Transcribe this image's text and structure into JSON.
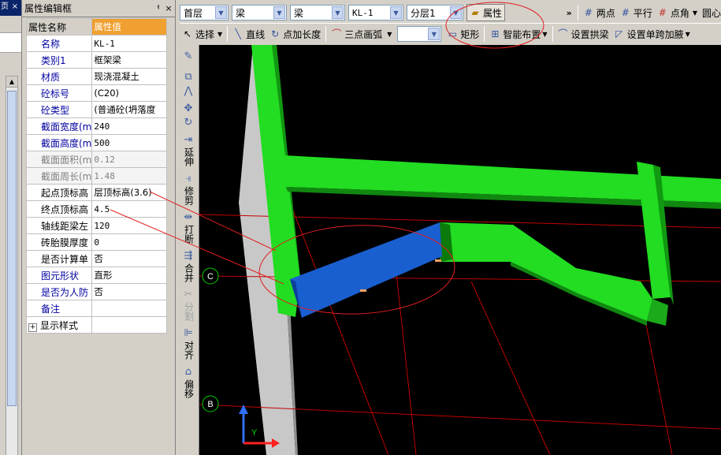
{
  "left_strip": {
    "tab_label": "页",
    "close": "×"
  },
  "prop_panel": {
    "title": "属性编辑框",
    "pin": "ᅣ",
    "close": "×",
    "header": {
      "name": "属性名称",
      "value": "属性值"
    },
    "rows": [
      {
        "name": "名称",
        "value": "KL-1",
        "color": "blue"
      },
      {
        "name": "类别1",
        "value": "框架梁",
        "color": "blue"
      },
      {
        "name": "材质",
        "value": "现浇混凝土",
        "color": "blue"
      },
      {
        "name": "砼标号",
        "value": "(C20)",
        "color": "blue"
      },
      {
        "name": "砼类型",
        "value": "(普通砼(坍落度",
        "color": "blue"
      },
      {
        "name": "截面宽度(m",
        "value": "240",
        "color": "blue"
      },
      {
        "name": "截面高度(m",
        "value": "500",
        "color": "blue"
      },
      {
        "name": "截面面积(m",
        "value": "0.12",
        "color": "gray"
      },
      {
        "name": "截面周长(m",
        "value": "1.48",
        "color": "gray"
      },
      {
        "name": "起点顶标高",
        "value": "层顶标高(3.6)",
        "color": "black"
      },
      {
        "name": "终点顶标高",
        "value": "4.5",
        "color": "black"
      },
      {
        "name": "轴线距梁左",
        "value": "120",
        "color": "black"
      },
      {
        "name": "砖胎膜厚度",
        "value": "0",
        "color": "black"
      },
      {
        "name": "是否计算单",
        "value": "否",
        "color": "black"
      },
      {
        "name": "图元形状",
        "value": "直形",
        "color": "blue"
      },
      {
        "name": "是否为人防",
        "value": "否",
        "color": "blue"
      },
      {
        "name": "备注",
        "value": "",
        "color": "blue"
      },
      {
        "name": "显示样式",
        "value": "",
        "color": "black",
        "expander": "+"
      }
    ]
  },
  "toolbar1": {
    "floor": "首层",
    "type1": "梁",
    "type2": "梁",
    "element": "KL-1",
    "layer": "分层1",
    "property_button": "属性",
    "more": "»",
    "two_points": "两点",
    "parallel": "平行",
    "point_angle": "点角",
    "circle": "圆心"
  },
  "toolbar2": {
    "select": "选择",
    "line": "直线",
    "point_length": "点加长度",
    "three_point_arc": "三点画弧",
    "rect": "矩形",
    "smart_layout": "智能布置",
    "set_arch_beam": "设置拱梁",
    "set_single_span": "设置单跨加腋"
  },
  "vtool": {
    "extend": "延伸",
    "trim": "修剪",
    "break": "打断",
    "merge": "合并",
    "split": "分割",
    "align": "对齐",
    "offset": "偏移"
  },
  "viewport": {
    "axis_c": "C",
    "axis_b": "B",
    "axis_y": "Y",
    "colors": {
      "beam_green": "#22dd22",
      "beam_selected": "#1a5fd0",
      "grid": "#c00000",
      "axis_circle": "#00cc00",
      "annotation": "#e02020"
    }
  }
}
